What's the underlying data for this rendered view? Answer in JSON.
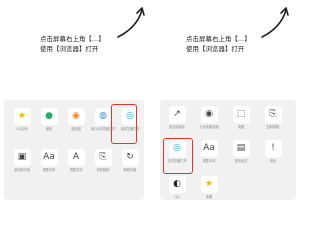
{
  "left": {
    "hint_line1": "点击屏幕右上角【...】",
    "hint_line2": "使用【浏览器】打开",
    "row1": [
      {
        "label": "QQ空间",
        "icon": "qzone-icon",
        "color": "#f5b800"
      },
      {
        "label": "微信",
        "icon": "wechat-icon",
        "color": "#2aae67"
      },
      {
        "label": "朋友圈",
        "icon": "moments-icon",
        "color": "#f08a24"
      },
      {
        "label": "用QQ浏览器打开",
        "icon": "qq-browser-icon",
        "color": "#3a8ee6"
      },
      {
        "label": "用浏览器打开",
        "icon": "browser-icon",
        "color": "#1aa3e8"
      }
    ],
    "row2": [
      {
        "label": "添加到浮窗",
        "icon": "float-window-icon",
        "color": "#444"
      },
      {
        "label": "调整字体",
        "icon": "font-size-icon",
        "color": "#444"
      },
      {
        "label": "调整字体",
        "icon": "font-icon",
        "color": "#444"
      },
      {
        "label": "复制链接",
        "icon": "link-icon",
        "color": "#444"
      },
      {
        "label": "刷新页面",
        "icon": "refresh-icon",
        "color": "#444"
      }
    ]
  },
  "right": {
    "hint_line1": "点击屏幕右上角【...】",
    "hint_line2": "使用【浏览器】打开",
    "row1": [
      {
        "label": "发送给朋友",
        "icon": "share-icon",
        "color": "#444"
      },
      {
        "label": "分享到朋友圈",
        "icon": "moments-icon",
        "color": "#444"
      },
      {
        "label": "收藏",
        "icon": "favorite-icon",
        "color": "#444"
      },
      {
        "label": "复制链接",
        "icon": "link-icon",
        "color": "#444"
      }
    ],
    "row2": [
      {
        "label": "在浏览器打开",
        "icon": "browser-icon",
        "color": "#1aa3e8"
      },
      {
        "label": "调整字体",
        "icon": "font-size-icon",
        "color": "#444"
      },
      {
        "label": "投诉反馈",
        "icon": "feedback-icon",
        "color": "#444"
      },
      {
        "label": "投诉",
        "icon": "complaint-icon",
        "color": "#444"
      }
    ],
    "row3": [
      {
        "label": "QQ",
        "icon": "qq-icon",
        "color": "#222"
      },
      {
        "label": "收藏",
        "icon": "star-icon",
        "color": "#f5b800"
      }
    ]
  },
  "colors": {
    "highlight": "#e8332d",
    "panel_bg": "#f1f1f1"
  }
}
